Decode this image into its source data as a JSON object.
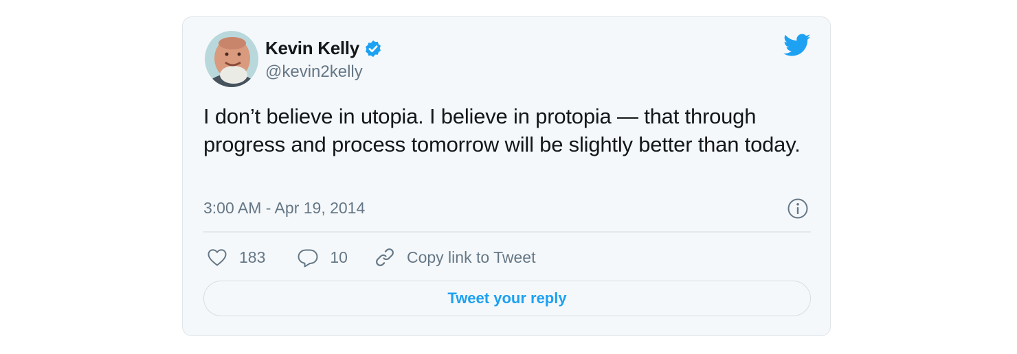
{
  "author": {
    "name": "Kevin Kelly",
    "handle": "@kevin2kelly",
    "verified": true
  },
  "tweet": {
    "text": "I don’t believe in utopia. I believe in protopia — that through progress and process tomorrow will be slightly better than today.",
    "timestamp": "3:00 AM - Apr 19, 2014"
  },
  "actions": {
    "likes": "183",
    "replies": "10",
    "copy_link_label": "Copy link to Tweet"
  },
  "reply_button_label": "Tweet your reply",
  "icons": {
    "brand": "twitter-bird-icon",
    "verified": "verified-badge-icon",
    "info": "info-icon",
    "like": "heart-icon",
    "reply": "speech-bubble-icon",
    "copy_link": "link-icon"
  },
  "colors": {
    "accent": "#1da1f2",
    "text_primary": "#14171a",
    "text_secondary": "#657786",
    "card_background": "#f5f8fa",
    "border": "#dfe4e8"
  }
}
